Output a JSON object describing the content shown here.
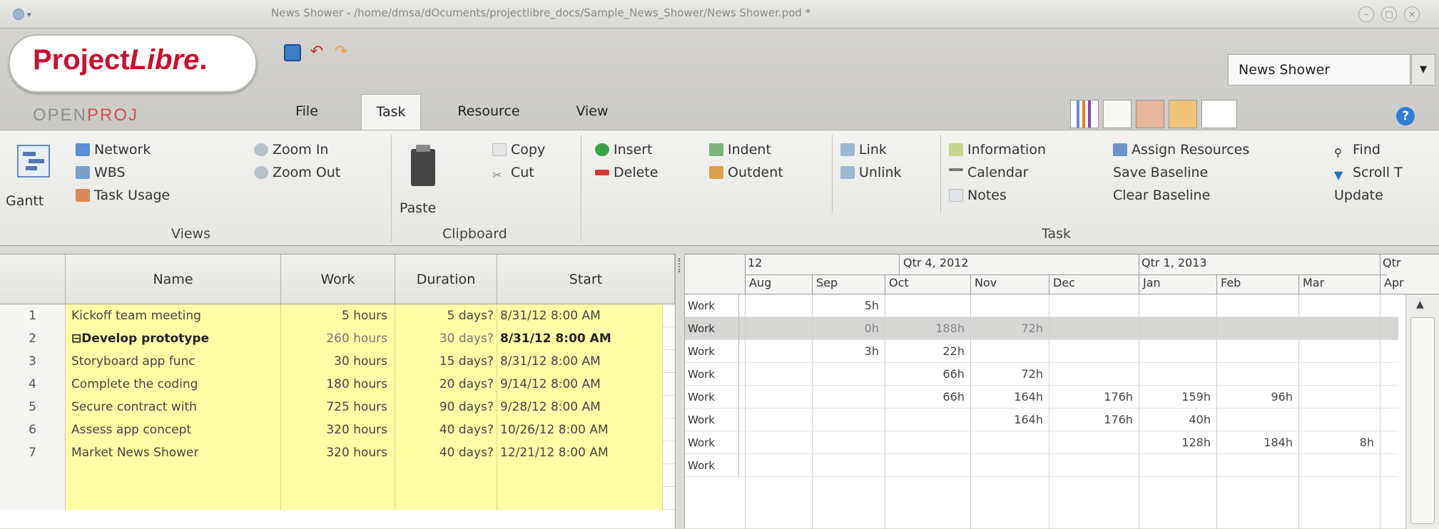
{
  "window": {
    "title": "News Shower - /home/dmsa/dOcuments/projectlibre_docs/Sample_News_Shower/News Shower.pod *"
  },
  "brand": {
    "logo_main": "Project",
    "logo_italic": "Libre",
    "logo_suffix": ".",
    "openproj_gray": "OPEN",
    "openproj_red": "PROJ"
  },
  "project_selector": {
    "value": "News Shower"
  },
  "tabs": [
    "File",
    "Task",
    "Resource",
    "View"
  ],
  "active_tab": "Task",
  "ribbon": {
    "views": {
      "gantt": "Gantt",
      "network": "Network",
      "wbs": "WBS",
      "task_usage": "Task Usage",
      "zoom_in": "Zoom In",
      "zoom_out": "Zoom Out",
      "group_label": "Views"
    },
    "clipboard": {
      "paste": "Paste",
      "copy": "Copy",
      "cut": "Cut",
      "group_label": "Clipboard"
    },
    "task": {
      "insert": "Insert",
      "delete": "Delete",
      "indent": "Indent",
      "outdent": "Outdent",
      "link": "Link",
      "unlink": "Unlink",
      "information": "Information",
      "calendar": "Calendar",
      "notes": "Notes",
      "assign_resources": "Assign Resources",
      "save_baseline": "Save Baseline",
      "clear_baseline": "Clear Baseline",
      "find": "Find",
      "scroll": "Scroll T",
      "update": "Update",
      "group_label": "Task"
    }
  },
  "table": {
    "headers": {
      "name": "Name",
      "work": "Work",
      "duration": "Duration",
      "start": "Start"
    },
    "rows": [
      {
        "id": "1",
        "name": "Kickoff team meeting",
        "work": "5 hours",
        "duration": "5 days?",
        "start": "8/31/12 8:00 AM",
        "summary": false
      },
      {
        "id": "2",
        "name": "⊟Develop prototype",
        "work": "260 hours",
        "duration": "30 days?",
        "start": "8/31/12 8:00 AM",
        "summary": true
      },
      {
        "id": "3",
        "name": "Storyboard app func",
        "work": "30 hours",
        "duration": "15 days?",
        "start": "8/31/12 8:00 AM",
        "summary": false
      },
      {
        "id": "4",
        "name": "Complete the coding",
        "work": "180 hours",
        "duration": "20 days?",
        "start": "9/14/12 8:00 AM",
        "summary": false
      },
      {
        "id": "5",
        "name": "Secure contract with",
        "work": "725 hours",
        "duration": "90 days?",
        "start": "9/28/12 8:00 AM",
        "summary": false
      },
      {
        "id": "6",
        "name": "Assess app concept",
        "work": "320 hours",
        "duration": "40 days?",
        "start": "10/26/12 8:00 AM",
        "summary": false
      },
      {
        "id": "7",
        "name": "Market News Shower",
        "work": "320 hours",
        "duration": "40 days?",
        "start": "12/21/12 8:00 AM",
        "summary": false
      }
    ]
  },
  "usage": {
    "header_top": [
      "12",
      "Qtr 4, 2012",
      "Qtr 1, 2013",
      "Qtr"
    ],
    "months": [
      "Aug",
      "Sep",
      "Oct",
      "Nov",
      "Dec",
      "Jan",
      "Feb",
      "Mar",
      "Apr"
    ],
    "row_label": "Work",
    "rows": [
      [
        "",
        "5h",
        "",
        "",
        "",
        "",
        "",
        ""
      ],
      [
        "",
        "0h",
        "188h",
        "72h",
        "",
        "",
        "",
        ""
      ],
      [
        "",
        "3h",
        "22h",
        "",
        "",
        "",
        "",
        ""
      ],
      [
        "",
        "",
        "66h",
        "72h",
        "",
        "",
        "",
        ""
      ],
      [
        "",
        "",
        "66h",
        "164h",
        "176h",
        "159h",
        "96h",
        ""
      ],
      [
        "",
        "",
        "",
        "164h",
        "176h",
        "40h",
        "",
        ""
      ],
      [
        "",
        "",
        "",
        "",
        "",
        "128h",
        "184h",
        "8h"
      ],
      [
        "",
        "",
        "",
        "",
        "",
        "",
        "",
        ""
      ]
    ]
  },
  "colors": {
    "task_cell": "#ffffa6",
    "logo_red": "#c8102e",
    "summary_row": "#d6d6d4",
    "help_blue": "#2f7ed8"
  }
}
